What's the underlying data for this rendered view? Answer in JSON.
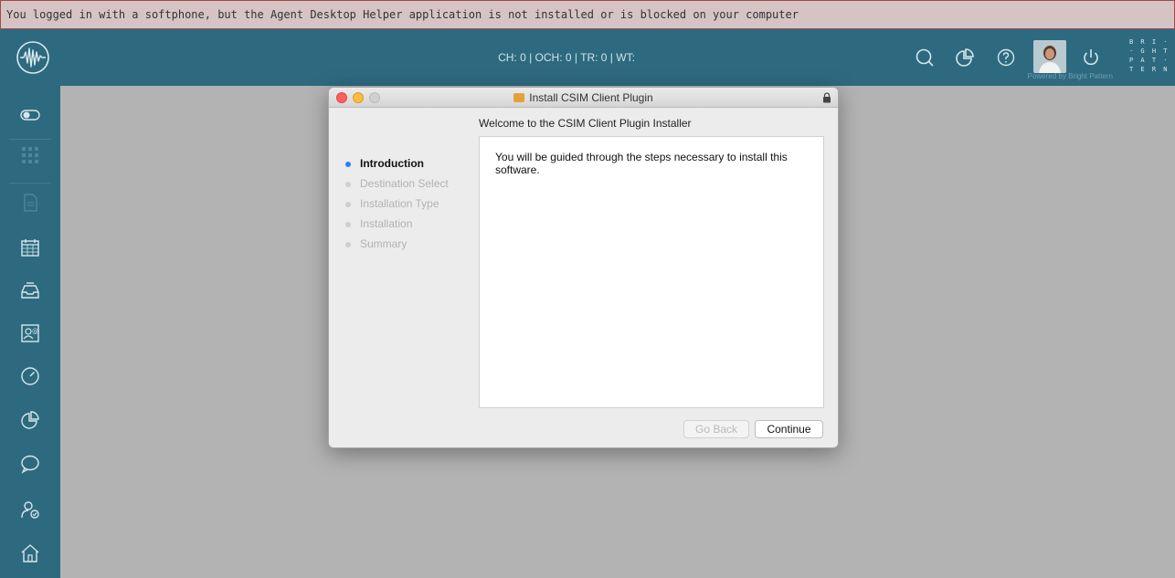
{
  "banner": {
    "message": "You logged in with a softphone, but the Agent Desktop Helper application is not installed or is blocked on your computer"
  },
  "topbar": {
    "status_text": "CH: 0  |  OCH: 0  |  TR: 0  |  WT:",
    "powered_by": "Powered by Bright Pattern",
    "brand_logo_text": "B R I ·\n· G H T\nP A T ·\nT E R N",
    "icons": [
      "search-icon",
      "reports-icon",
      "help-icon",
      "power-icon"
    ]
  },
  "sidebar": {
    "icons": [
      "toggle-icon",
      "dialpad-icon",
      "documents-icon",
      "calendar-icon",
      "inbox-icon",
      "contacts-icon",
      "dashboard-icon",
      "reports-icon",
      "chat-icon",
      "user-status-icon",
      "home-icon"
    ]
  },
  "installer": {
    "window_title": "Install CSIM Client Plugin",
    "heading": "Welcome to the CSIM Client Plugin Installer",
    "body_text": "You will be guided through the steps necessary to install this software.",
    "steps": [
      {
        "label": "Introduction",
        "active": true
      },
      {
        "label": "Destination Select",
        "active": false
      },
      {
        "label": "Installation Type",
        "active": false
      },
      {
        "label": "Installation",
        "active": false
      },
      {
        "label": "Summary",
        "active": false
      }
    ],
    "go_back_label": "Go Back",
    "continue_label": "Continue"
  },
  "colors": {
    "sidebar": "#2d6a80",
    "banner_bg": "#d6c4c4",
    "banner_border": "#a04a4a",
    "content_bg": "#b3b3b3",
    "active_step": "#2f7ef6",
    "traffic_close": "#fc605c",
    "traffic_minimize": "#fdbc40",
    "traffic_zoom": "#d0d0d0"
  }
}
